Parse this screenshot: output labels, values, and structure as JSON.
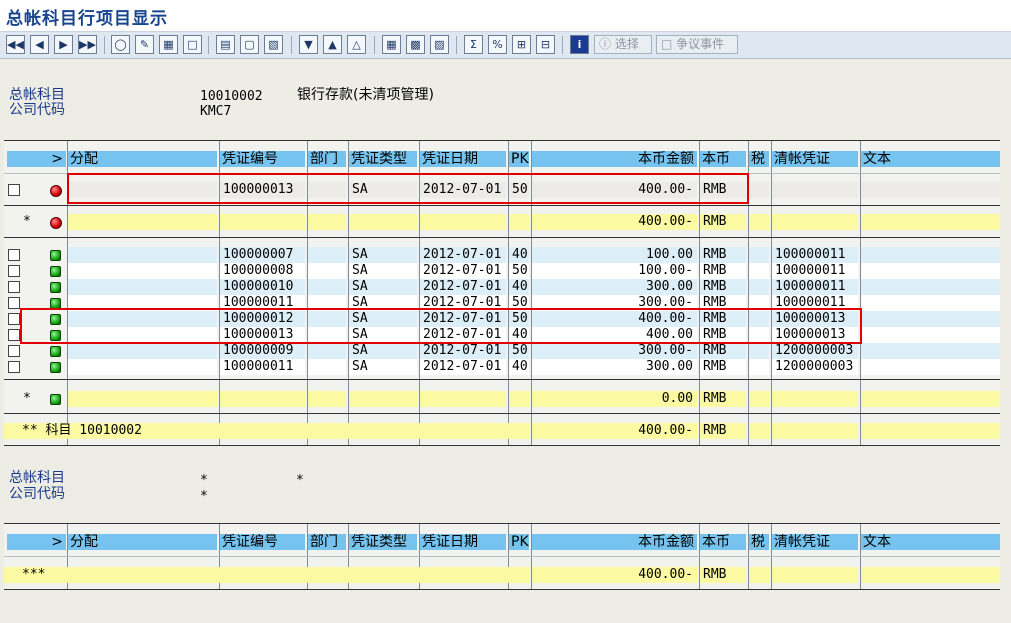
{
  "title": "总帐科目行项目显示",
  "toolbar": {
    "select_label": "选择",
    "dispute_label": "争议事件"
  },
  "header1": {
    "account_label": "总帐科目",
    "company_label": "公司代码",
    "account_value": "10010002",
    "account_desc": "银行存款(未清项管理)",
    "company_value": "KMC7"
  },
  "columns": {
    "expand": ">",
    "assignment": "分配",
    "doc_no": "凭证编号",
    "dept": "部门",
    "doc_type": "凭证类型",
    "doc_date": "凭证日期",
    "pk": "PK",
    "amount": "本币金额",
    "currency": "本币",
    "tax": "税",
    "clearing": "清帐凭证",
    "text": "文本"
  },
  "open_items": [
    {
      "doc_no": "100000013",
      "doc_type": "SA",
      "doc_date": "2012-07-01",
      "pk": "50",
      "amount": "400.00-",
      "currency": "RMB",
      "clearing": ""
    }
  ],
  "open_subtotal": {
    "star": "*",
    "amount": "400.00-",
    "currency": "RMB"
  },
  "cleared_items": [
    {
      "doc_no": "100000007",
      "doc_type": "SA",
      "doc_date": "2012-07-01",
      "pk": "40",
      "amount": "100.00",
      "currency": "RMB",
      "clearing": "100000011"
    },
    {
      "doc_no": "100000008",
      "doc_type": "SA",
      "doc_date": "2012-07-01",
      "pk": "50",
      "amount": "100.00-",
      "currency": "RMB",
      "clearing": "100000011"
    },
    {
      "doc_no": "100000010",
      "doc_type": "SA",
      "doc_date": "2012-07-01",
      "pk": "40",
      "amount": "300.00",
      "currency": "RMB",
      "clearing": "100000011"
    },
    {
      "doc_no": "100000011",
      "doc_type": "SA",
      "doc_date": "2012-07-01",
      "pk": "50",
      "amount": "300.00-",
      "currency": "RMB",
      "clearing": "100000011"
    },
    {
      "doc_no": "100000012",
      "doc_type": "SA",
      "doc_date": "2012-07-01",
      "pk": "50",
      "amount": "400.00-",
      "currency": "RMB",
      "clearing": "100000013"
    },
    {
      "doc_no": "100000013",
      "doc_type": "SA",
      "doc_date": "2012-07-01",
      "pk": "40",
      "amount": "400.00",
      "currency": "RMB",
      "clearing": "100000013"
    },
    {
      "doc_no": "100000009",
      "doc_type": "SA",
      "doc_date": "2012-07-01",
      "pk": "50",
      "amount": "300.00-",
      "currency": "RMB",
      "clearing": "1200000003"
    },
    {
      "doc_no": "100000011",
      "doc_type": "SA",
      "doc_date": "2012-07-01",
      "pk": "40",
      "amount": "300.00",
      "currency": "RMB",
      "clearing": "1200000003"
    }
  ],
  "cleared_subtotal": {
    "star": "*",
    "amount": "0.00",
    "currency": "RMB"
  },
  "account_total": {
    "label": "** 科目 10010002",
    "amount": "400.00-",
    "currency": "RMB"
  },
  "header2": {
    "account_label": "总帐科目",
    "company_label": "公司代码",
    "account_value": "*",
    "account_desc": "*",
    "company_value": "*"
  },
  "grand_total": {
    "label": "***",
    "amount": "400.00-",
    "currency": "RMB"
  },
  "colors": {
    "header_cell": "#75c3ee",
    "total_row": "#fbfaa3",
    "highlight_box": "#e00000",
    "title": "#18458f"
  }
}
